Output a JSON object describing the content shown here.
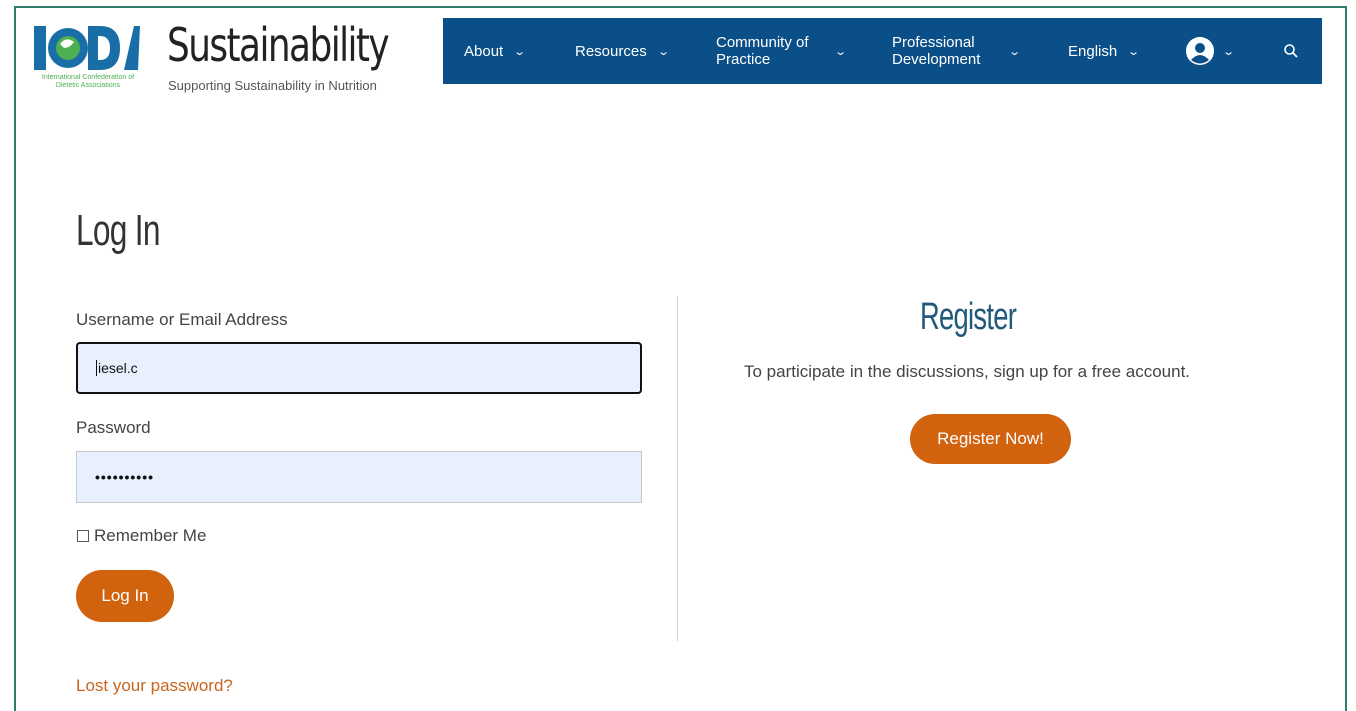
{
  "header": {
    "logo_text": "ICDA",
    "logo_subtext": "International Confederation of Dietetic Associations",
    "site_title": "Sustainability",
    "tagline": "Supporting Sustainability in Nutrition"
  },
  "nav": {
    "items": [
      {
        "label": "About"
      },
      {
        "label": "Resources"
      },
      {
        "label": "Community of Practice"
      },
      {
        "label": "Professional Development"
      },
      {
        "label": "English"
      }
    ],
    "user_icon": "user-circle-icon",
    "search_icon": "search-icon",
    "background": "#0b4f88"
  },
  "login": {
    "title": "Log In",
    "username_label": "Username or Email Address",
    "username_value": "iesel.c",
    "password_label": "Password",
    "password_value": "••••••••••",
    "remember_label": "Remember Me",
    "login_button": "Log In",
    "lost_password": "Lost your password?"
  },
  "register": {
    "title": "Register",
    "text": "To participate in the discussions, sign up for a free account.",
    "button": "Register Now!"
  },
  "colors": {
    "accent_button": "#d1620e",
    "frame": "#2e7d6b",
    "input_bg": "#e8f0fe"
  }
}
